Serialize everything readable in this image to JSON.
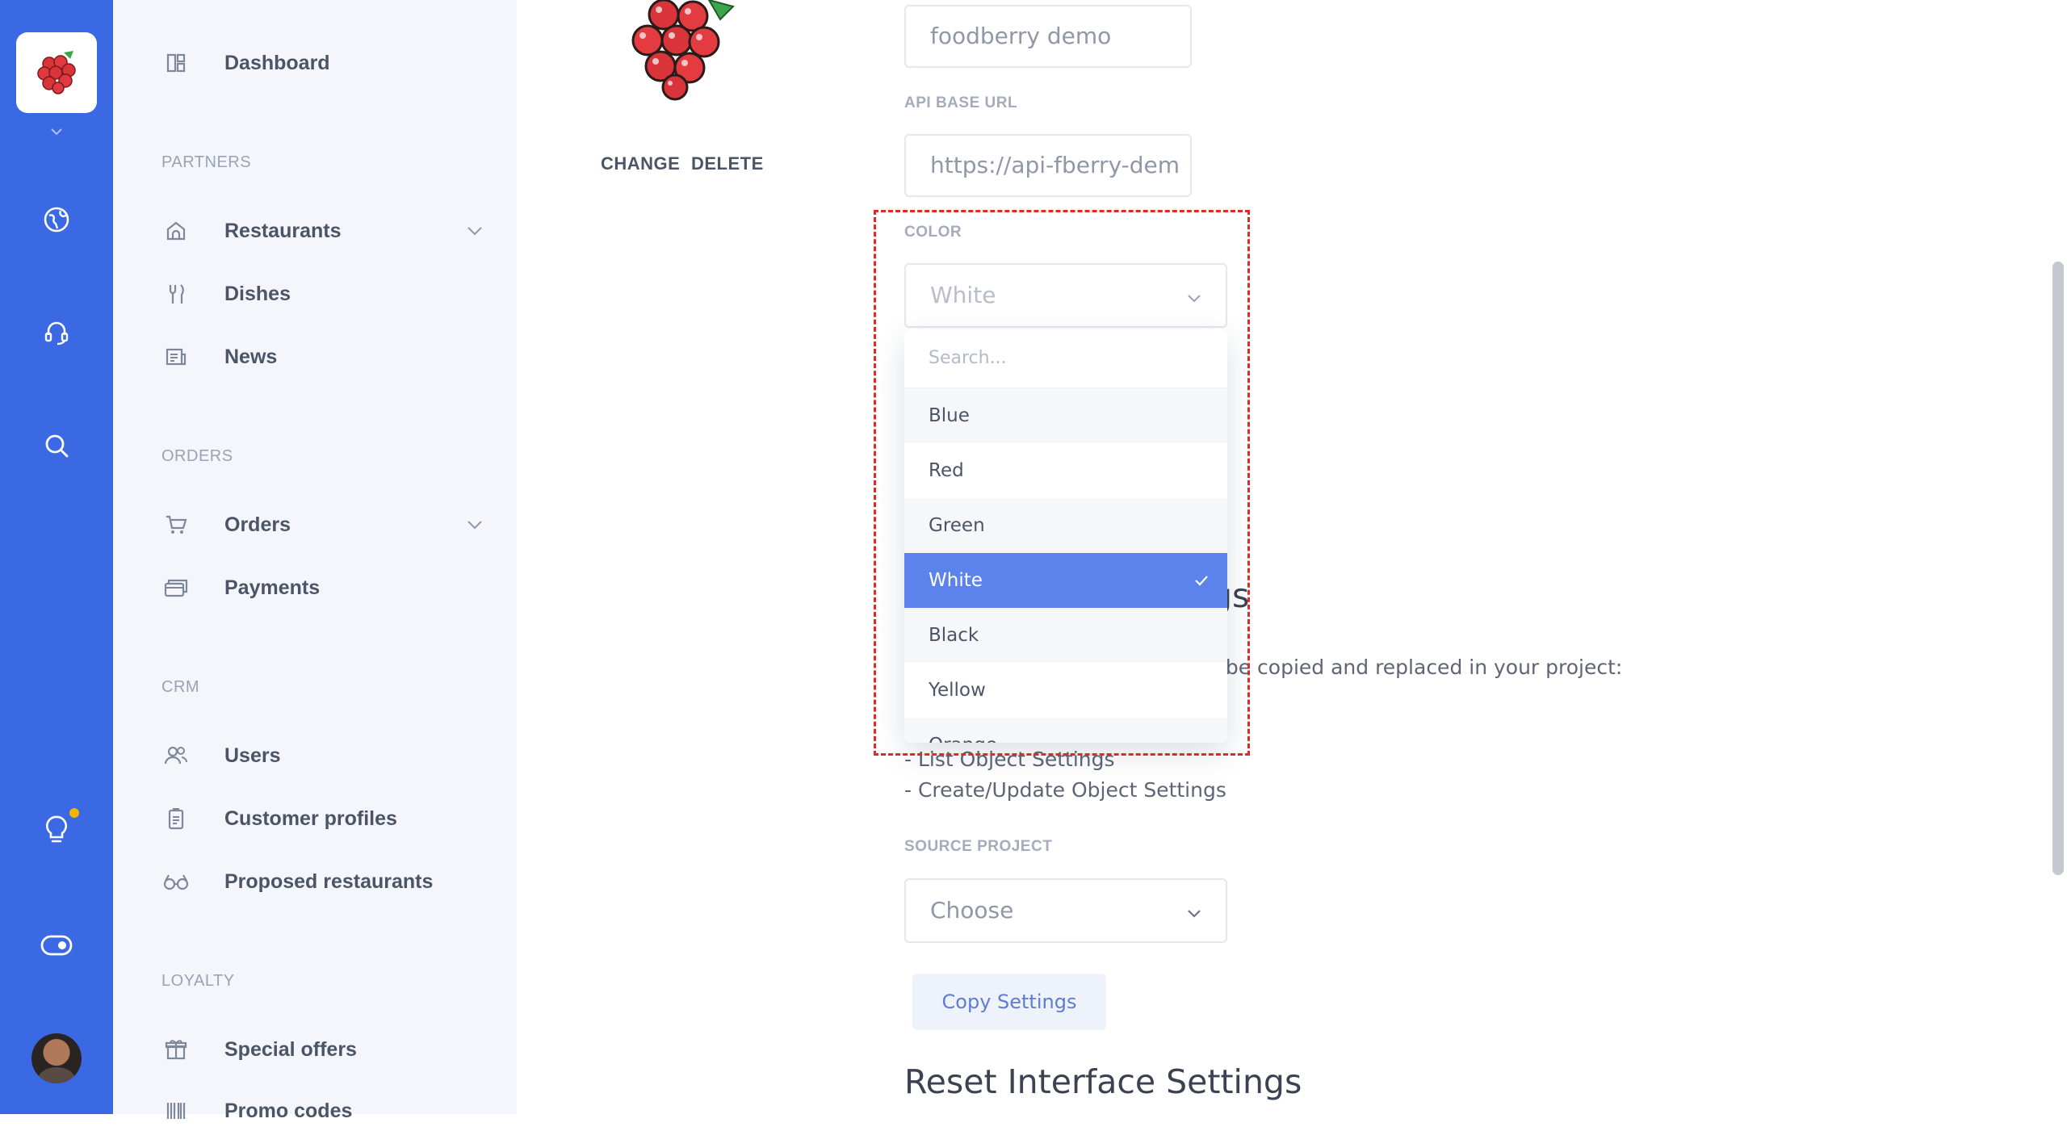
{
  "sidebar": {
    "items": [
      {
        "label": "Dashboard",
        "icon": "dashboard-icon"
      },
      {
        "label": "Restaurants",
        "icon": "restaurant-icon"
      },
      {
        "label": "Dishes",
        "icon": "cutlery-icon"
      },
      {
        "label": "News",
        "icon": "news-icon"
      },
      {
        "label": "Orders",
        "icon": "cart-icon"
      },
      {
        "label": "Payments",
        "icon": "payments-icon"
      },
      {
        "label": "Users",
        "icon": "users-icon"
      },
      {
        "label": "Customer profiles",
        "icon": "clipboard-icon"
      },
      {
        "label": "Proposed restaurants",
        "icon": "glasses-icon"
      },
      {
        "label": "Special offers",
        "icon": "gift-icon"
      },
      {
        "label": "Promo codes",
        "icon": "barcode-icon"
      }
    ],
    "sections": {
      "partners": "PARTNERS",
      "orders": "ORDERS",
      "crm": "CRM",
      "loyalty": "LOYALTY"
    }
  },
  "rail": {
    "icons": [
      "raspberry-logo-icon",
      "chevron-down-icon",
      "globe-icon",
      "support-icon",
      "search-icon",
      "lightbulb-icon",
      "toggle-icon",
      "avatar"
    ]
  },
  "logo": {
    "change": "CHANGE",
    "delete": "DELETE"
  },
  "form": {
    "project_name_value": "foodberry demo",
    "api_label": "API BASE URL",
    "api_value": "https://api-fberry-dem",
    "color_label": "COLOR",
    "color_value": "White",
    "search_placeholder": "Search...",
    "options": [
      "Blue",
      "Red",
      "Green",
      "White",
      "Black",
      "Yellow",
      "Orange"
    ],
    "selected_option": "White"
  },
  "copy_section": {
    "heading_tail": "gs",
    "description_tail": "ll be copied and replaced in your project:",
    "line1": "- List Object Settings",
    "line2": "- Create/Update Object Settings",
    "source_label": "SOURCE PROJECT",
    "source_placeholder": "Choose",
    "button": "Copy Settings"
  },
  "reset_section": {
    "heading": "Reset Interface Settings"
  },
  "colors": {
    "rail": "#3b68e3",
    "sidebar_bg": "#f4f6fb",
    "selected": "#5c82ec",
    "highlight": "#e02a2a",
    "notification": "#f7b500"
  }
}
